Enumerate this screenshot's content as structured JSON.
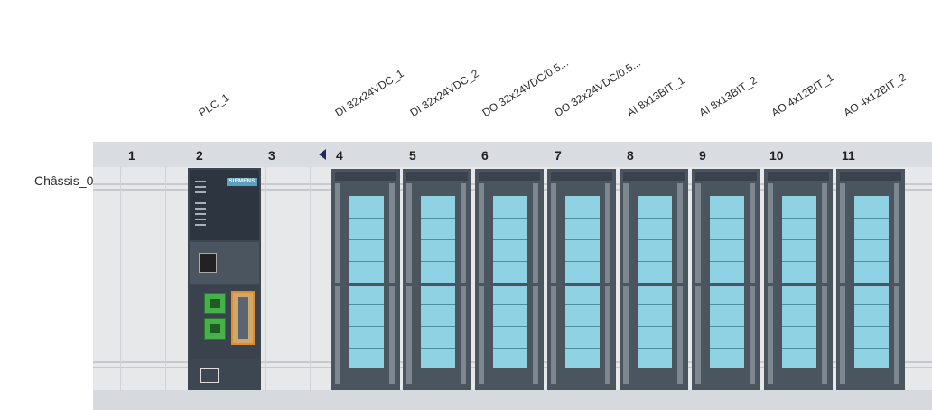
{
  "modules_top_labels": [
    {
      "text": "PLC_1"
    },
    {
      "text": "DI 32x24VDC_1"
    },
    {
      "text": "DI 32x24VDC_2"
    },
    {
      "text": "DO 32x24VDC/0.5..."
    },
    {
      "text": "DO 32x24VDC/0.5..."
    },
    {
      "text": "AI 8x13BIT_1"
    },
    {
      "text": "AI 8x13BIT_2"
    },
    {
      "text": "AO 4x12BIT_1"
    },
    {
      "text": "AO 4x12BIT_2"
    }
  ],
  "slots": [
    "1",
    "2",
    "3",
    "4",
    "5",
    "6",
    "7",
    "8",
    "9",
    "10",
    "11"
  ],
  "rack": {
    "name": "Châssis_0"
  },
  "plc": {
    "brand": "SIEMENS"
  },
  "colors": {
    "header": "#d9dde2",
    "rack": "#e6e8ea",
    "module": "#4a5560",
    "screen": "#8fd2e3",
    "plc_port": "#46b04a",
    "profibus_port": "#e08c2c",
    "slot_arrow": "#1d2b5c"
  }
}
